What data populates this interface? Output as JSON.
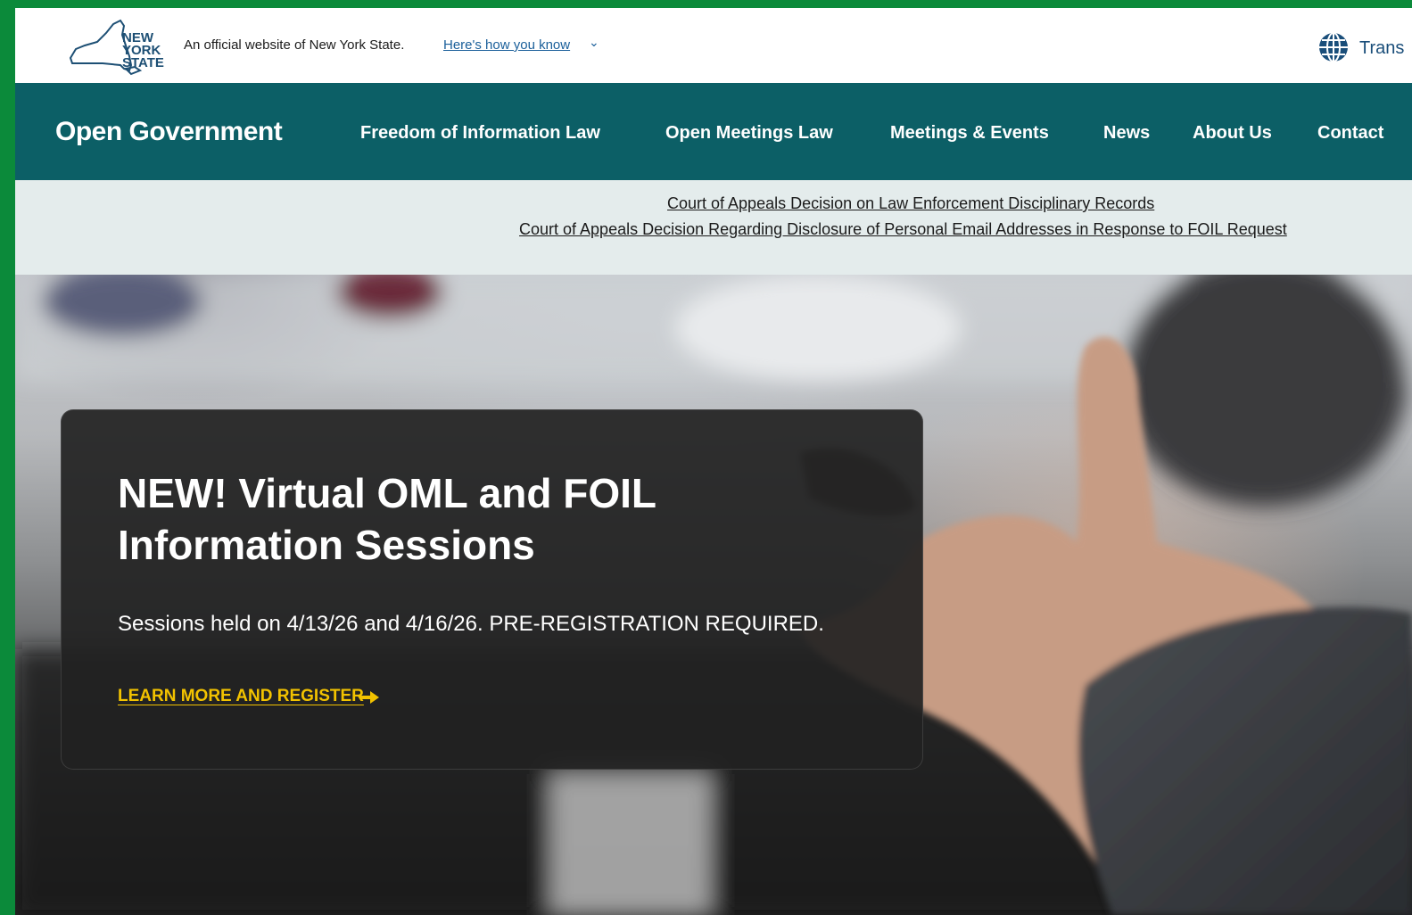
{
  "official_banner": {
    "logo_text": [
      "NEW",
      "YORK",
      "STATE"
    ],
    "official_text": "An official website of New York State.",
    "how_you_know_link": "Here's how you know",
    "chevron_icon": "chevron-down-icon",
    "translate_icon": "globe-icon",
    "translate_label": "Trans"
  },
  "nav": {
    "site_title": "Open Government",
    "items": [
      {
        "label": "Freedom of Information Law"
      },
      {
        "label": "Open Meetings Law"
      },
      {
        "label": "Meetings & Events"
      },
      {
        "label": "News"
      },
      {
        "label": "About Us"
      },
      {
        "label": "Contact"
      }
    ],
    "background_color": "#0c5f66"
  },
  "alerts": {
    "links": [
      "Court of Appeals Decision on Law Enforcement Disciplinary Records",
      "Court of Appeals Decision Regarding Disclosure of Personal Email Addresses in Response to FOIL Request"
    ],
    "background_color": "#e4ecec"
  },
  "hero": {
    "title": "NEW! Virtual OML and FOIL Information Sessions",
    "text": "Sessions held on 4/13/26 and 4/16/26. PRE-REGISTRATION REQUIRED.",
    "cta_label": "LEARN MORE AND REGISTER",
    "cta_icon": "arrow-right-icon",
    "cta_color": "#f2c200"
  }
}
